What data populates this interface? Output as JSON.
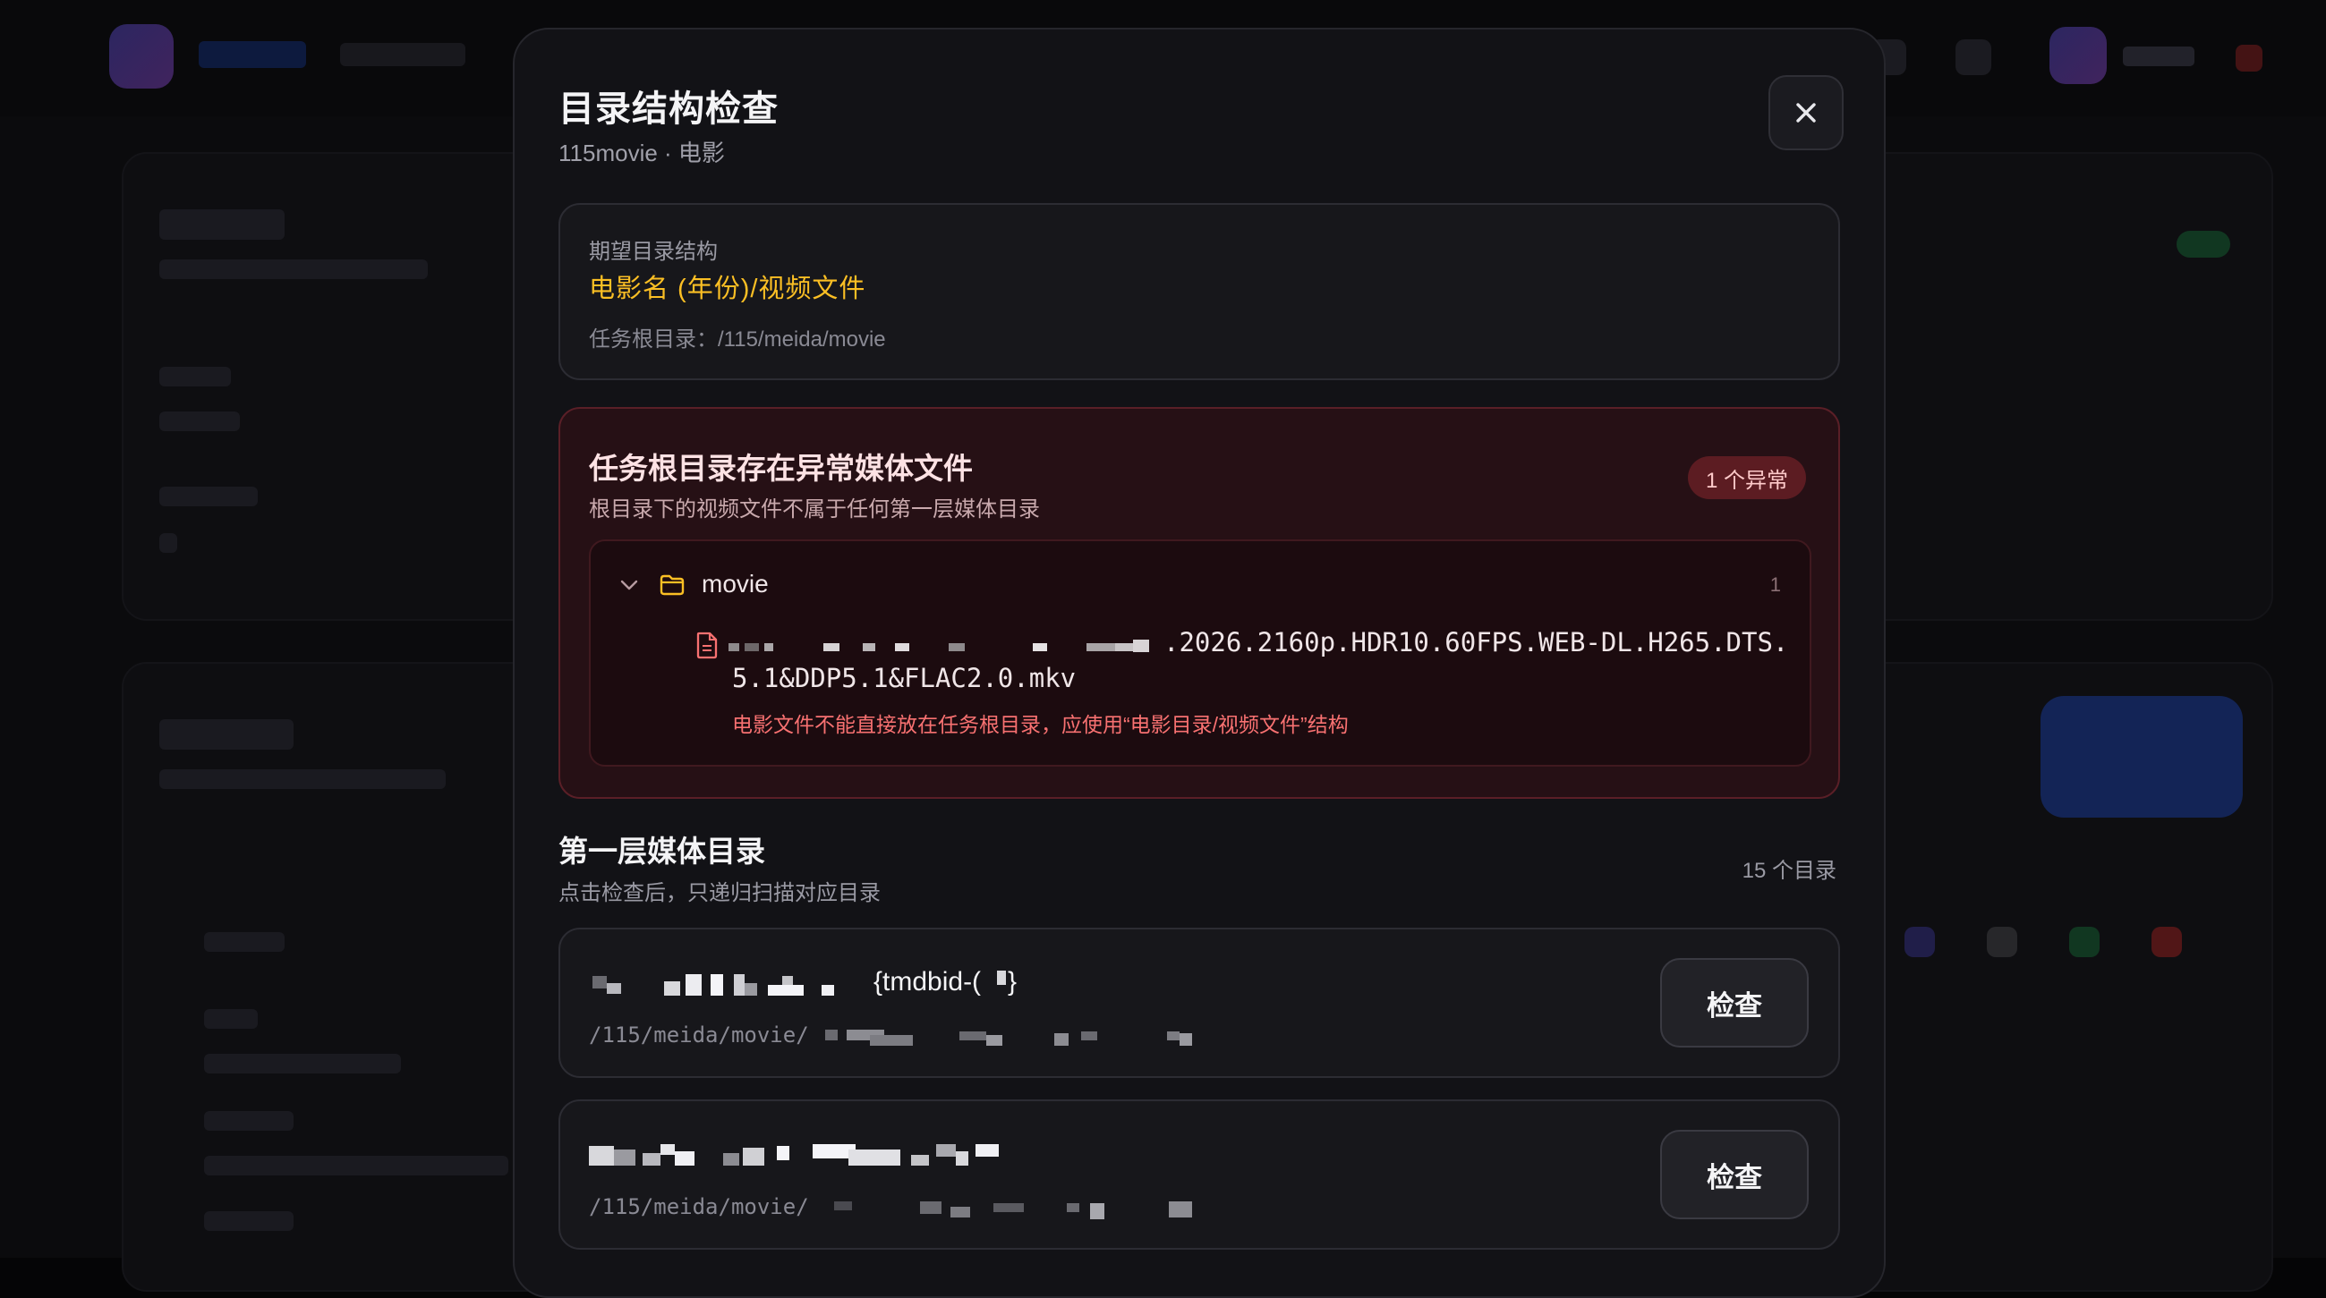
{
  "modal": {
    "title": "目录结构检查",
    "subtitle": "115movie · 电影",
    "close_icon": "close-icon"
  },
  "expected": {
    "label": "期望目录结构",
    "pattern": "电影名 (年份)/视频文件",
    "root": "任务根目录：/115/meida/movie"
  },
  "anomaly": {
    "title": "任务根目录存在异常媒体文件",
    "description": "根目录下的视频文件不属于任何第一层媒体目录",
    "badge": "1 个异常",
    "folder": {
      "name": "movie",
      "count": "1",
      "icon": "folder-icon"
    },
    "file": {
      "icon": "file-icon",
      "name_line1": ".2026.2160p.HDR10.60FPS.WEB-DL.H265.DTS.",
      "name_line2": "5.1&DDP5.1&FLAC2.0.mkv",
      "error": "电影文件不能直接放在任务根目录，应使用“电影目录/视频文件”结构"
    }
  },
  "media_dirs": {
    "title": "第一层媒体目录",
    "description": "点击检查后，只递归扫描对应目录",
    "count": "15 个目录",
    "items": [
      {
        "name_suffix": "{tmdbid-(",
        "name_close": "}",
        "path": "/115/meida/movie/",
        "button": "检查"
      },
      {
        "name_suffix": "",
        "name_close": "",
        "path": "/115/meida/movie/",
        "button": "检查"
      }
    ]
  },
  "colors": {
    "accent_warning": "#fbbf24",
    "error": "#f87171",
    "error_bg": "#261015"
  }
}
